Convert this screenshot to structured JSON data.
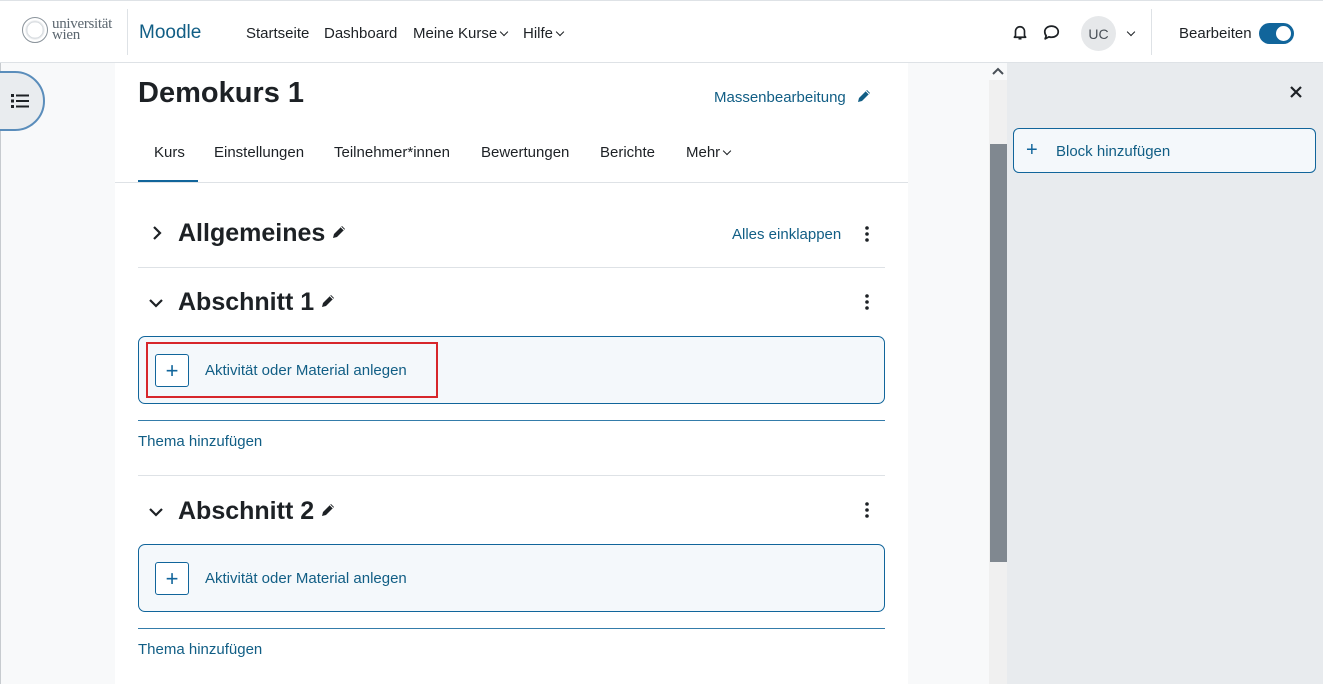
{
  "navbar": {
    "logo_line1": "universität",
    "logo_line2": "wien",
    "brand": "Moodle",
    "links": [
      "Startseite",
      "Dashboard",
      "Meine Kurse",
      "Hilfe"
    ],
    "avatar_initials": "UC",
    "edit_mode_label": "Bearbeiten",
    "edit_mode_on": true
  },
  "course": {
    "title": "Demokurs 1",
    "bulk_edit": "Massenbearbeitung",
    "tabs": [
      "Kurs",
      "Einstellungen",
      "Teilnehmer*innen",
      "Bewertungen",
      "Berichte",
      "Mehr"
    ],
    "active_tab": "Kurs",
    "collapse_all": "Alles einklappen",
    "sections": [
      {
        "title": "Allgemeines",
        "expanded": false
      },
      {
        "title": "Abschnitt 1",
        "expanded": true,
        "add_label": "Aktivität oder Material anlegen",
        "add_topic": "Thema hinzufügen"
      },
      {
        "title": "Abschnitt 2",
        "expanded": true,
        "add_label": "Aktivität oder Material anlegen",
        "add_topic": "Thema hinzufügen"
      }
    ]
  },
  "block_drawer": {
    "add_block": "Block hinzufügen"
  },
  "icons": {
    "drawer": "list-icon",
    "notifications": "bell-icon",
    "messages": "chat-icon",
    "close": "close-icon"
  },
  "colors": {
    "accent": "#11659b",
    "highlight": "#d7262b"
  }
}
